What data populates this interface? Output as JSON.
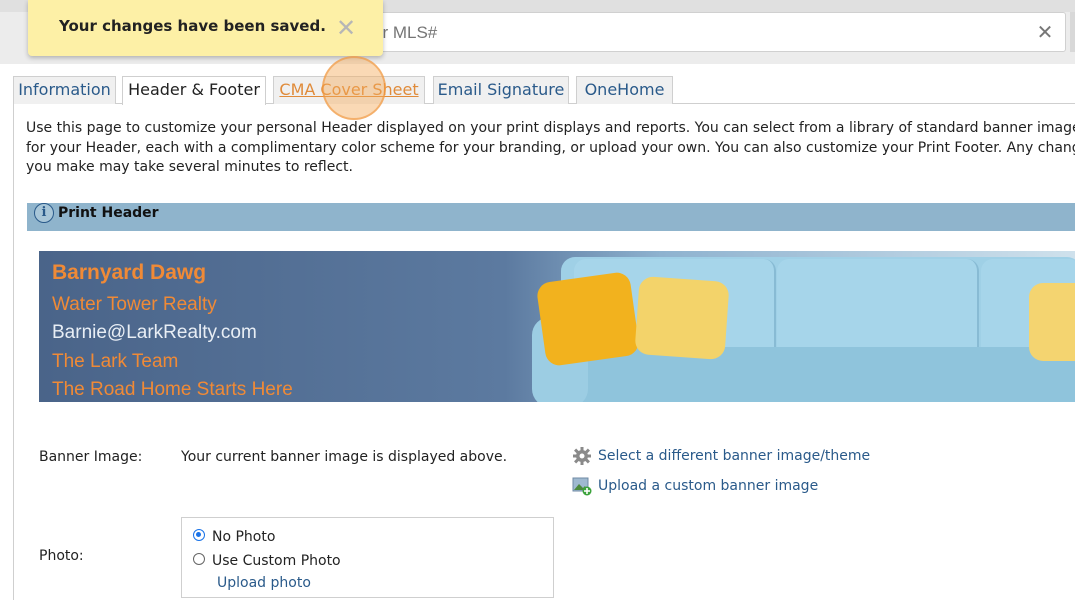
{
  "search": {
    "placeholder": "or MLS#"
  },
  "toast": {
    "message": "Your changes have been saved."
  },
  "tabs": [
    {
      "label": "Information"
    },
    {
      "label": "Header & Footer"
    },
    {
      "label": "CMA Cover Sheet"
    },
    {
      "label": "Email Signature"
    },
    {
      "label": "OneHome"
    }
  ],
  "intro": {
    "line1": "Use this page to customize your personal Header displayed on your print displays and reports. You can select from a library of standard banner images",
    "line2": "for your Header, each with a complimentary color scheme for your branding, or upload your own. You can also customize your Print Footer. Any change",
    "line3": "you make may take several minutes to reflect."
  },
  "print_header": {
    "title": "Print Header"
  },
  "banner": {
    "name": "Barnyard Dawg",
    "company": "Water Tower Realty",
    "email": "Barnie@LarkRealty.com",
    "team": "The Lark Team",
    "slogan": "The Road Home Starts Here"
  },
  "banner_image": {
    "label": "Banner Image:",
    "value": "Your current banner image is displayed above.",
    "select_link": "Select a different banner image/theme",
    "upload_link": "Upload a custom banner image"
  },
  "photo": {
    "label": "Photo:",
    "option_none": "No Photo",
    "option_custom": "Use Custom Photo",
    "upload_link": "Upload photo",
    "selected": "No Photo"
  },
  "colors": {
    "link": "#2a5a8a",
    "banner_text": "#f08a36",
    "section_bar": "#8fb4cc",
    "toast_bg": "#fdf0a6"
  }
}
